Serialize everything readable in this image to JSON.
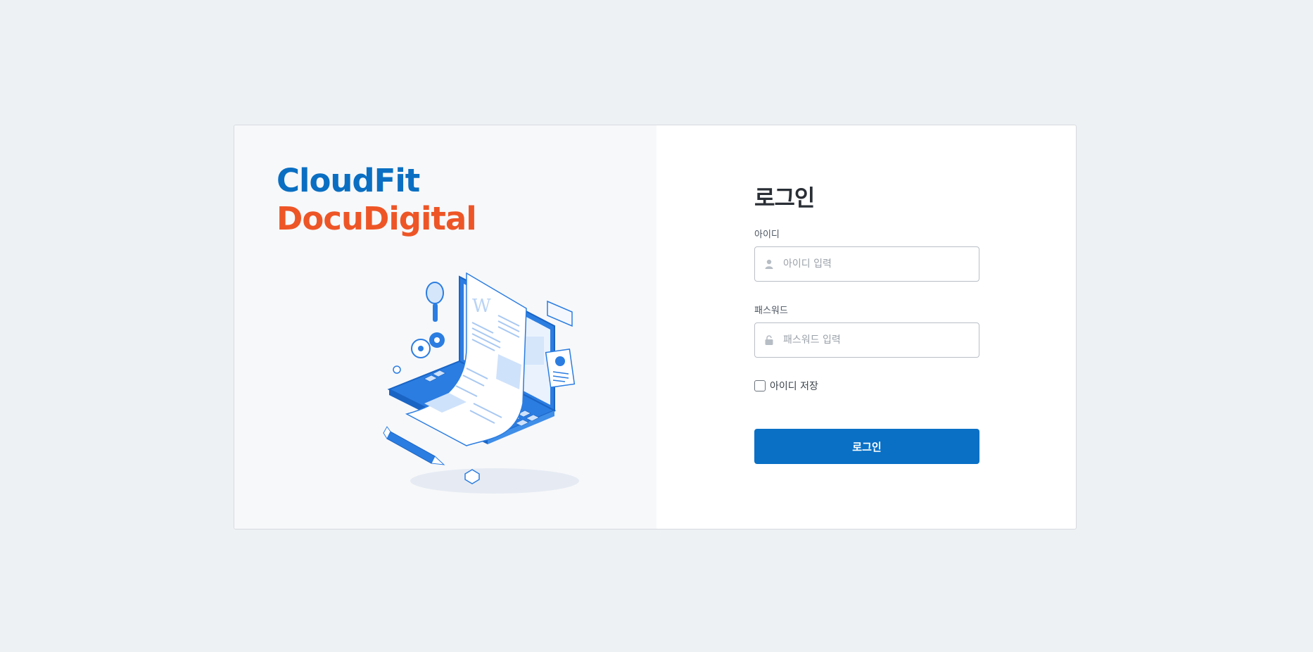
{
  "brand": {
    "line1": "CloudFit",
    "line2": "DocuDigital",
    "primary_color": "#0a6fc2",
    "secondary_color": "#ee5526"
  },
  "illustration": {
    "icon": "laptop-document-illustration"
  },
  "login": {
    "title": "로그인",
    "id_label": "아이디",
    "id_placeholder": "아이디 입력",
    "id_icon": "user-icon",
    "password_label": "패스워드",
    "password_placeholder": "패스워드 입력",
    "password_icon": "lock-icon",
    "remember_label": "아이디 저장",
    "remember_checked": false,
    "submit_label": "로그인",
    "button_color": "#0a70c6"
  }
}
